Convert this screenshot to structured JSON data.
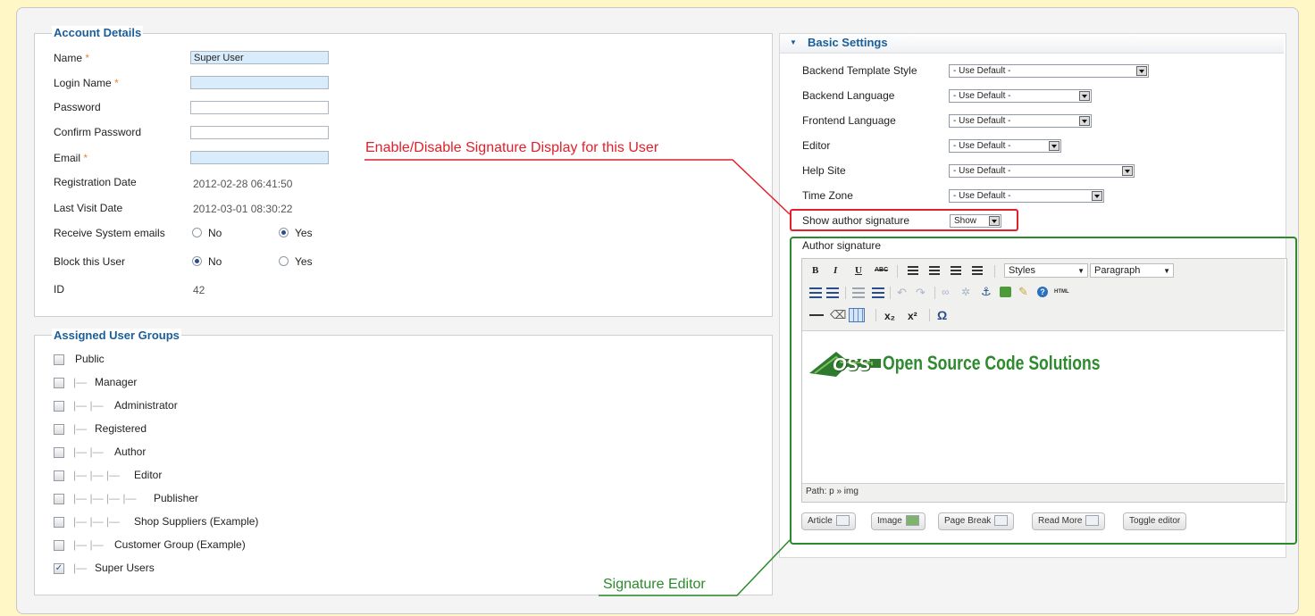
{
  "account": {
    "legend": "Account Details",
    "fields": {
      "name_label": "Name",
      "name_value": "Super User",
      "login_label": "Login Name",
      "password_label": "Password",
      "confirm_label": "Confirm Password",
      "email_label": "Email",
      "required_mark": "*",
      "reg_label": "Registration Date",
      "reg_value": "2012-02-28 06:41:50",
      "visit_label": "Last Visit Date",
      "visit_value": "2012-03-01 08:30:22",
      "sys_label": "Receive System emails",
      "block_label": "Block this User",
      "no": "No",
      "yes": "Yes",
      "id_label": "ID",
      "id_value": "42"
    }
  },
  "groups": {
    "legend": "Assigned User Groups",
    "items": [
      {
        "label": "Public",
        "prefix": "",
        "checked": false
      },
      {
        "label": "Manager",
        "prefix": "|—",
        "checked": false
      },
      {
        "label": "Administrator",
        "prefix": "|— |—",
        "checked": false
      },
      {
        "label": "Registered",
        "prefix": "|—",
        "checked": false
      },
      {
        "label": "Author",
        "prefix": "|— |—",
        "checked": false
      },
      {
        "label": "Editor",
        "prefix": "|— |— |—",
        "checked": false
      },
      {
        "label": "Publisher",
        "prefix": "|— |— |— |—",
        "checked": false
      },
      {
        "label": "Shop Suppliers (Example)",
        "prefix": "|— |— |—",
        "checked": false
      },
      {
        "label": "Customer Group (Example)",
        "prefix": "|— |—",
        "checked": false
      },
      {
        "label": "Super Users",
        "prefix": "|—",
        "checked": true
      }
    ],
    "check_mark": "✓"
  },
  "basic": {
    "title": "Basic Settings",
    "toggle_glyph": "▼",
    "rows": {
      "template_label": "Backend Template Style",
      "template_value": "- Use Default -",
      "blang_label": "Backend Language",
      "blang_value": "- Use Default -",
      "flang_label": "Frontend Language",
      "flang_value": "- Use Default -",
      "editor_label": "Editor",
      "editor_value": "- Use Default -",
      "help_label": "Help Site",
      "help_value": "- Use Default -",
      "tz_label": "Time Zone",
      "tz_value": "- Use Default -",
      "sig_label": "Show author signature",
      "sig_value": "Show"
    }
  },
  "editor": {
    "label": "Author signature",
    "toolbar": {
      "bold": "B",
      "italic": "I",
      "underline": "U",
      "strike": "ABC",
      "styles": "Styles",
      "paragraph": "Paragraph",
      "html": "HTML",
      "sub": "x₂",
      "sup": "x²",
      "omega": "Ω"
    },
    "logo_text": "Open Source Code Solutions",
    "logo_badge": "OSS",
    "path": "Path: p » img",
    "buttons": [
      "Article",
      "Image",
      "Page Break",
      "Read More",
      "Toggle editor"
    ]
  },
  "annotations": {
    "signature_display": "Enable/Disable Signature Display for this User",
    "signature_editor": "Signature Editor"
  },
  "colors": {
    "legend": "#1a5e99",
    "annotation_red": "#e2202b",
    "annotation_green": "#2b8a2b",
    "field_blue": "#d9ecfb"
  }
}
